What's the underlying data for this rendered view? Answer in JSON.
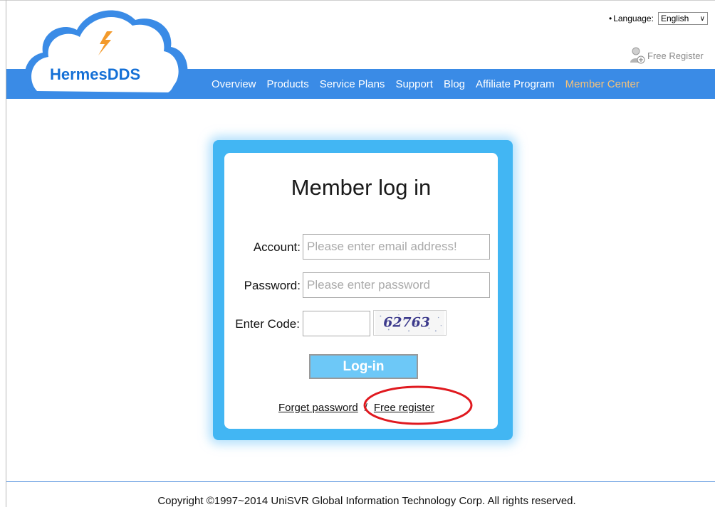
{
  "brand": {
    "name": "HermesDDS"
  },
  "language": {
    "label": "Language:",
    "selected": "English"
  },
  "top_register": {
    "label": "Free Register"
  },
  "nav": {
    "items": [
      {
        "label": "Overview"
      },
      {
        "label": "Products"
      },
      {
        "label": "Service Plans"
      },
      {
        "label": "Support"
      },
      {
        "label": "Blog"
      },
      {
        "label": "Affiliate Program"
      },
      {
        "label": "Member Center",
        "active": true
      }
    ]
  },
  "login": {
    "title": "Member log in",
    "account_label": "Account:",
    "account_placeholder": "Please enter email address!",
    "password_label": "Password:",
    "password_placeholder": "Please enter password",
    "code_label": "Enter Code:",
    "code_value": "",
    "captcha_text": "62763",
    "button_label": "Log-in",
    "forget_link": "Forget password",
    "separator": "/",
    "register_link": "Free register"
  },
  "footer": {
    "copyright": "Copyright ©1997~2014 UniSVR Global Information Technology Corp. All rights reserved."
  },
  "colors": {
    "nav_bg": "#3a8be6",
    "card_bg": "#42b6f3",
    "active_nav": "#f5c27a",
    "annotation": "#e0191f"
  }
}
